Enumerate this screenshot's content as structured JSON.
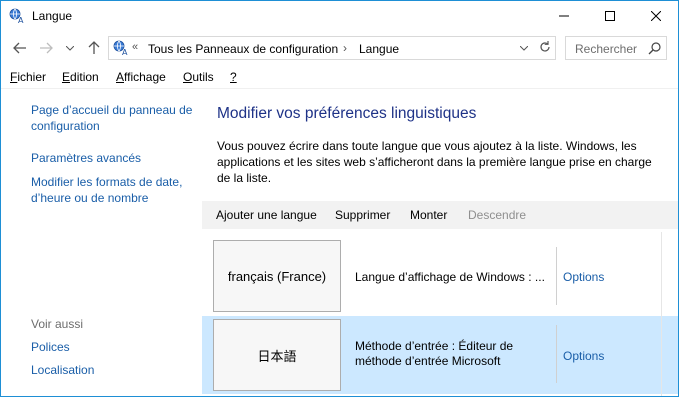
{
  "window": {
    "title": "Langue",
    "icon": "language-globe-icon"
  },
  "address": {
    "chevron": "«",
    "crumbs": [
      "Tous les Panneaux de configuration",
      "Langue"
    ],
    "separator": "›",
    "search_placeholder": "Rechercher"
  },
  "menu": {
    "items": [
      {
        "first": "F",
        "rest": "ichier"
      },
      {
        "first": "E",
        "rest": "dition"
      },
      {
        "first": "A",
        "rest": "ffichage"
      },
      {
        "first": "O",
        "rest": "utils"
      },
      {
        "first": "?",
        "rest": ""
      }
    ]
  },
  "sidebar": {
    "links": [
      {
        "line1": "Page d’accueil du panneau de",
        "line2": "configuration"
      },
      {
        "line1": "Paramètres avancés",
        "line2": ""
      },
      {
        "line1": "Modifier les formats de date,",
        "line2": "d’heure ou de nombre"
      }
    ],
    "see_also_title": "Voir aussi",
    "see_also": [
      "Polices",
      "Localisation"
    ]
  },
  "main": {
    "title": "Modifier vos préférences linguistiques",
    "description": "Vous pouvez écrire dans toute langue que vous ajoutez à la liste. Windows, les applications et les sites web s’afficheront dans la première langue prise en charge de la liste.",
    "toolbar": {
      "add": "Ajouter une langue",
      "remove": "Supprimer",
      "up": "Monter",
      "down": "Descendre"
    },
    "languages": [
      {
        "name": "français (France)",
        "desc_line1": "Langue d’affichage de Windows : ...",
        "desc_line2": "",
        "options": "Options",
        "selected": false
      },
      {
        "name": "日本語",
        "desc_line1": "Méthode d’entrée : Éditeur de",
        "desc_line2": "méthode d’entrée Microsoft",
        "options": "Options",
        "selected": true
      }
    ]
  },
  "colors": {
    "link": "#1a5ea8",
    "title": "#1e3287",
    "selection": "#cce8ff",
    "border": "#1e8fd5"
  }
}
